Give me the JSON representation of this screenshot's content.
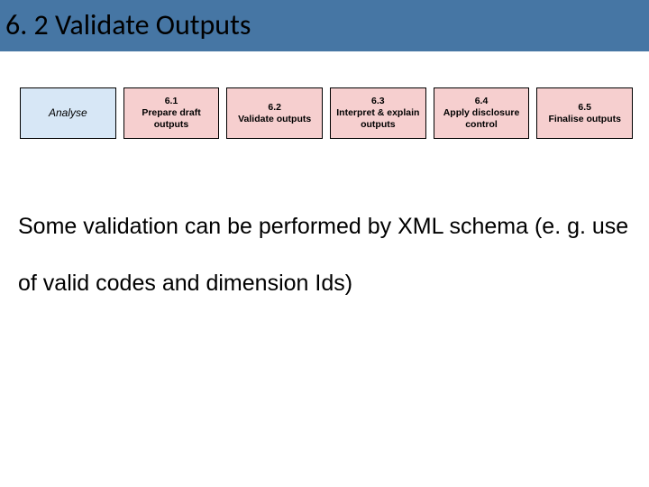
{
  "title": "6. 2 Validate Outputs",
  "flow": {
    "analyse_label": "Analyse",
    "steps": [
      {
        "num": "6.1",
        "label": "Prepare draft outputs"
      },
      {
        "num": "6.2",
        "label": "Validate outputs"
      },
      {
        "num": "6.3",
        "label": "Interpret & explain outputs"
      },
      {
        "num": "6.4",
        "label": "Apply disclosure control"
      },
      {
        "num": "6.5",
        "label": "Finalise outputs"
      }
    ]
  },
  "body": "Some validation can be performed by XML schema (e. g. use of valid codes and dimension Ids)"
}
